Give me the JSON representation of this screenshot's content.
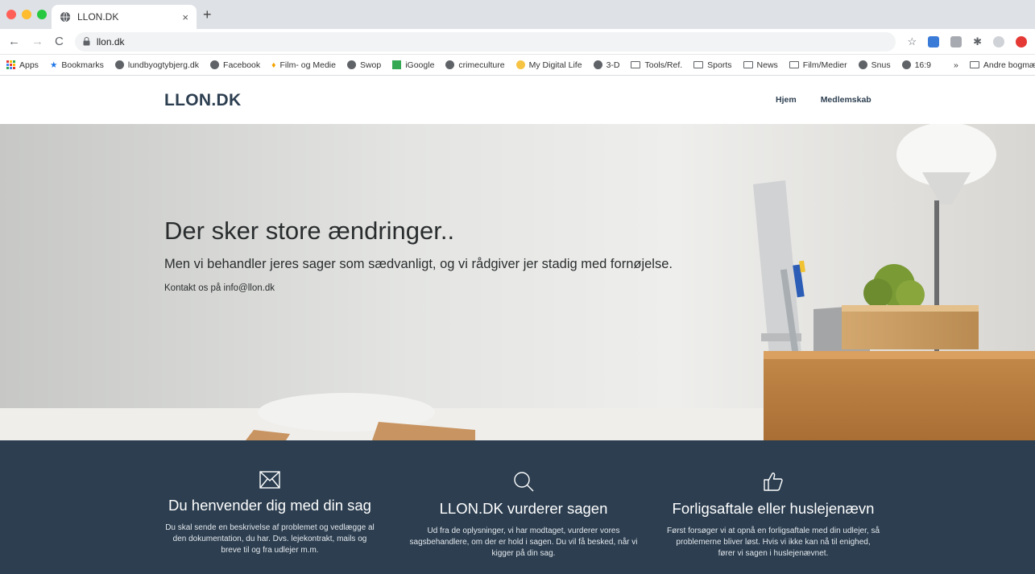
{
  "browser": {
    "tab_title": "LLON.DK",
    "tab_close": "×",
    "new_tab": "+",
    "url": "llon.dk",
    "bookmarks": [
      {
        "label": "Apps",
        "icon": "apps-grid-icon"
      },
      {
        "label": "Bookmarks",
        "icon": "star-icon"
      },
      {
        "label": "lundbyogtybjerg.dk",
        "icon": "globe-icon"
      },
      {
        "label": "Facebook",
        "icon": "globe-icon"
      },
      {
        "label": "Film- og Medie",
        "icon": "pin-icon"
      },
      {
        "label": "Swop",
        "icon": "globe-icon"
      },
      {
        "label": "iGoogle",
        "icon": "igoogle-icon"
      },
      {
        "label": "crimeculture",
        "icon": "globe-icon"
      },
      {
        "label": "My Digital Life",
        "icon": "bulb-icon"
      },
      {
        "label": "3-D",
        "icon": "globe-icon"
      },
      {
        "label": "Tools/Ref.",
        "icon": "folder-icon"
      },
      {
        "label": "Sports",
        "icon": "folder-icon"
      },
      {
        "label": "News",
        "icon": "folder-icon"
      },
      {
        "label": "Film/Medier",
        "icon": "folder-icon"
      },
      {
        "label": "Snus",
        "icon": "globe-icon"
      },
      {
        "label": "16:9",
        "icon": "globe-icon"
      }
    ],
    "bookmarks_overflow": "»",
    "other_bookmarks": "Andre bogmærker"
  },
  "site": {
    "logo": "LLON.DK",
    "nav": [
      "Hjem",
      "Medlemskab"
    ]
  },
  "hero": {
    "title": "Der sker store ændringer..",
    "subtitle": "Men vi behandler jeres sager som sædvanligt, og vi rådgiver jer stadig med fornøjelse.",
    "contact": "Kontakt os på info@llon.dk"
  },
  "features": [
    {
      "icon": "envelope-icon",
      "title": "Du henvender dig med din sag",
      "text": "Du skal sende en beskrivelse af problemet og vedlægge al den dokumentation, du har. Dvs. lejekontrakt, mails og breve til og fra udlejer m.m."
    },
    {
      "icon": "search-icon",
      "title": "LLON.DK vurderer sagen",
      "text": "Ud fra de oplysninger, vi har modtaget, vurderer vores sagsbehandlere, om der er hold i sagen. Du vil få besked, når vi kigger på din sag."
    },
    {
      "icon": "thumbs-up-icon",
      "title": "Forligsaftale eller huslejenævn",
      "text": "Først forsøger vi at opnå en forligsaftale med din udlejer, så problemerne bliver løst. Hvis vi ikke kan nå til enighed, fører vi sagen i huslejenævnet."
    }
  ],
  "colors": {
    "brand_dark": "#2c3e50"
  }
}
